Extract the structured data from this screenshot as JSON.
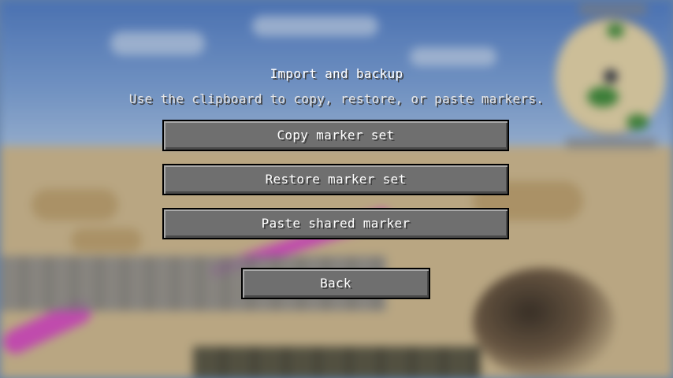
{
  "screen": {
    "title": "Import and backup",
    "subtitle": "Use the clipboard to copy, restore, or paste markers."
  },
  "buttons": {
    "copy_label": "Copy marker set",
    "restore_label": "Restore marker set",
    "paste_label": "Paste shared marker",
    "back_label": "Back"
  },
  "colors": {
    "button_face": "#6f6f6f",
    "button_border": "#000000",
    "text": "#ffffff",
    "text_shadow": "#3f3f3f"
  }
}
